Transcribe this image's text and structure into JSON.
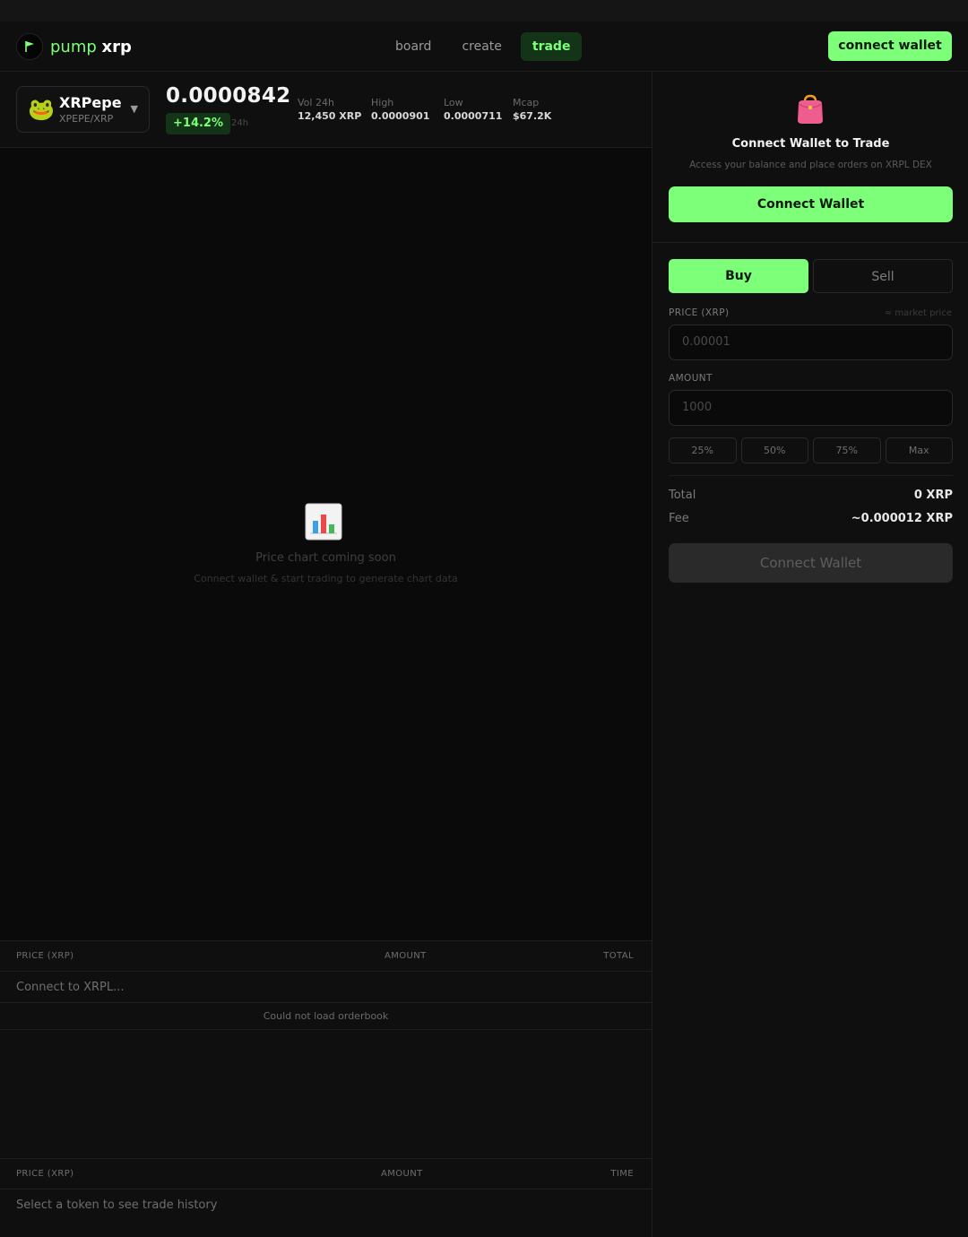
{
  "colors": {
    "accent": "#7dff7a",
    "background": "#0f0f0f",
    "chart_bg": "#0a0a0a",
    "muted": "#6e6e6e"
  },
  "nav": {
    "brand_left": "pump",
    "brand_right": "xrp",
    "links": [
      {
        "label": "board"
      },
      {
        "label": "create"
      },
      {
        "label": "trade",
        "active": true
      }
    ],
    "connect_label": "connect wallet"
  },
  "ticker": {
    "token_emoji": "🐸",
    "token_name": "XRPepe",
    "pair": "XPEPE/XRP",
    "price": "0.0000842",
    "change": "+14.2%",
    "change_period": "24h",
    "stats": [
      {
        "label": "Vol 24h",
        "value": "12,450 XRP"
      },
      {
        "label": "High",
        "value": "0.0000901"
      },
      {
        "label": "Low",
        "value": "0.0000711"
      },
      {
        "label": "Mcap",
        "value": "$67.2K"
      }
    ]
  },
  "chart": {
    "icon": "bar-chart-icon",
    "title": "Price chart coming soon",
    "subtitle": "Connect wallet & start trading to generate chart data"
  },
  "orderbook": {
    "headers": [
      "PRICE (XRP)",
      "AMOUNT",
      "TOTAL"
    ],
    "status": "Connect to XRPL...",
    "error": "Could not load orderbook"
  },
  "trade_history": {
    "headers": [
      "PRICE (XRP)",
      "AMOUNT",
      "TIME"
    ],
    "empty": "Select a token to see trade history"
  },
  "wallet_box": {
    "icon": "purse-icon",
    "title": "Connect Wallet to Trade",
    "subtitle": "Access your balance and place orders on XRPL DEX",
    "button": "Connect Wallet"
  },
  "order_form": {
    "tabs": [
      "Buy",
      "Sell"
    ],
    "price_label": "PRICE (XRP)",
    "price_hint": "≈ market price",
    "price_placeholder": "0.00001",
    "amount_label": "AMOUNT",
    "amount_placeholder": "1000",
    "percents": [
      "25%",
      "50%",
      "75%",
      "Max"
    ],
    "total_label": "Total",
    "total_value": "0 XRP",
    "fee_label": "Fee",
    "fee_value": "~0.000012 XRP",
    "submit": "Connect Wallet"
  }
}
